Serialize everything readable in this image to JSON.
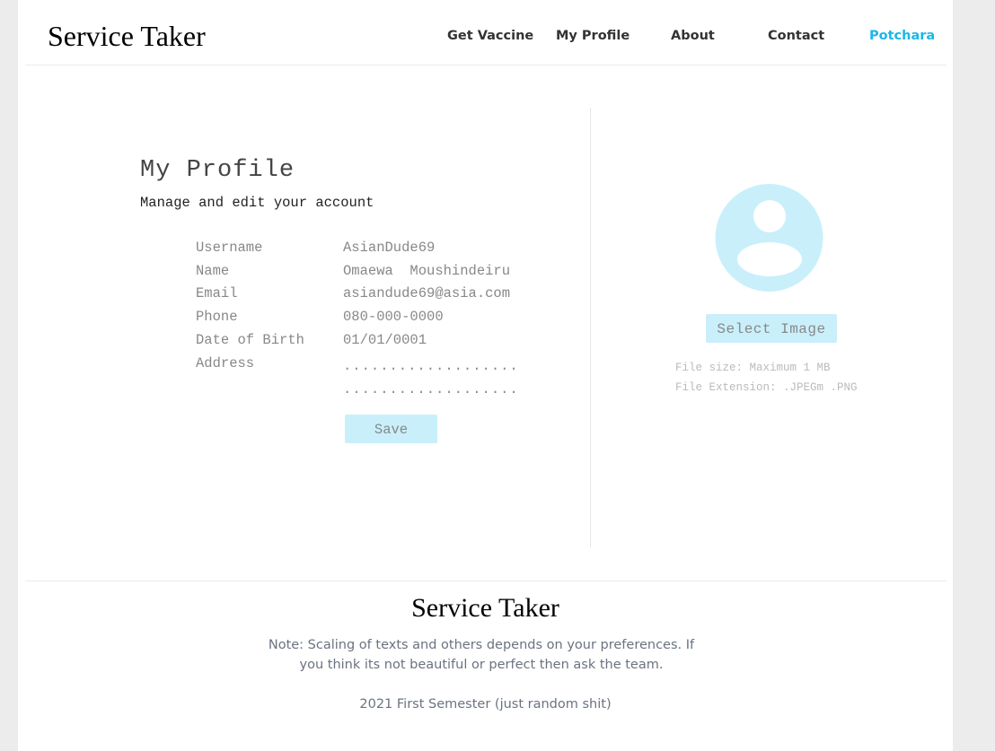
{
  "header": {
    "brand": "Service Taker",
    "nav": [
      "Get Vaccine",
      "My Profile",
      "About",
      "Contact",
      "Potchara"
    ],
    "active_nav": "Potchara",
    "accent_color": "#1ab8e6"
  },
  "profile": {
    "title": "My Profile",
    "subtitle": "Manage and edit your account",
    "fields": [
      {
        "label": "Username",
        "value": "AsianDude69"
      },
      {
        "label": "Name",
        "value": "Omaewa  Moushindeiru"
      },
      {
        "label": "Email",
        "value": "asiandude69@asia.com"
      },
      {
        "label": "Phone",
        "value": "080-000-0000"
      },
      {
        "label": "Date of Birth",
        "value": "01/01/0001"
      },
      {
        "label": "Address",
        "value": "...................",
        "value2": "..................."
      }
    ],
    "save_label": "Save",
    "button_color": "#c9effb"
  },
  "image_panel": {
    "avatar_icon": "user-avatar-icon",
    "select_label": "Select Image",
    "file_size_note": "File size: Maximum 1 MB",
    "file_ext_note": "File Extension: .JPEGm .PNG"
  },
  "footer": {
    "brand": "Service Taker",
    "note_line1": "Note: Scaling of texts and others depends on your preferences. If",
    "note_line2": "you think its not beautiful or perfect then ask the team.",
    "year_text": "2021 First Semester (just random shit)"
  }
}
